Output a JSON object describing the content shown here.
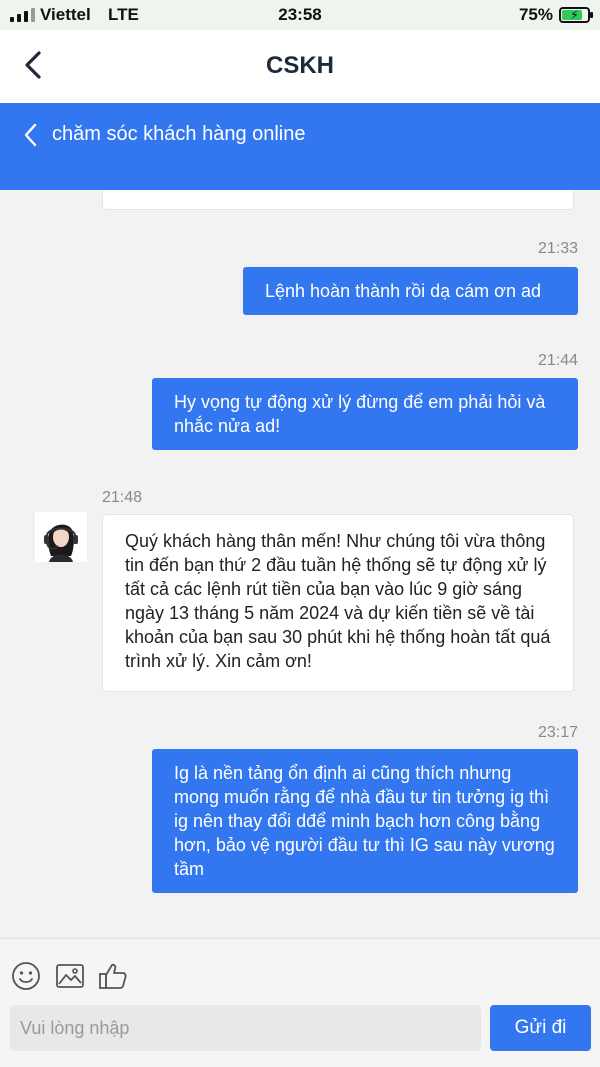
{
  "status_bar": {
    "carrier": "Viettel",
    "network": "LTE",
    "time": "23:58",
    "battery_percent": "75%",
    "battery_level": 0.75,
    "battery_color": "#34c759"
  },
  "nav": {
    "title": "CSKH",
    "back_icon": "chevron-left-icon"
  },
  "chat_header": {
    "title": "chăm sóc khách hàng online",
    "back_icon": "chevron-left-icon",
    "color": "#3377f0"
  },
  "messages": [
    {
      "time": "21:33",
      "direction": "outgoing",
      "text": "Lệnh hoàn thành rồi dạ cám ơn ad"
    },
    {
      "time": "21:44",
      "direction": "outgoing",
      "text": "Hy vọng tự động xử lý đừng để em phải hỏi và nhắc nửa ad!"
    },
    {
      "time": "21:48",
      "direction": "incoming",
      "text": "Quý khách hàng thân mến! Như chúng tôi vừa thông tin đến bạn thứ 2 đầu tuần hệ thống sẽ tự động xử lý tất cả các lệnh rút tiền của bạn vào lúc 9 giờ sáng ngày 13 tháng 5 năm 2024 và dự kiến tiền sẽ về tài khoản của bạn sau 30 phút khi hệ thống hoàn tất quá trình xử lý. Xin cảm ơn!"
    },
    {
      "time": "23:17",
      "direction": "outgoing",
      "text": "Ig là nền tảng ổn định ai cũng thích nhưng mong muốn rằng để nhà đầu tư tin tưởng ig thì ig nên thay đổi dđể minh bạch hơn công bằng hơn, bảo vệ người đầu tư thì IG sau này vương tầm"
    }
  ],
  "toolbar": {
    "icons": [
      "smiley-icon",
      "image-icon",
      "thumbs-up-icon"
    ],
    "input_placeholder": "Vui lòng nhập",
    "input_value": "",
    "send_label": "Gửi đi"
  },
  "colors": {
    "accent": "#3377f0",
    "background": "#f2f2f2"
  }
}
